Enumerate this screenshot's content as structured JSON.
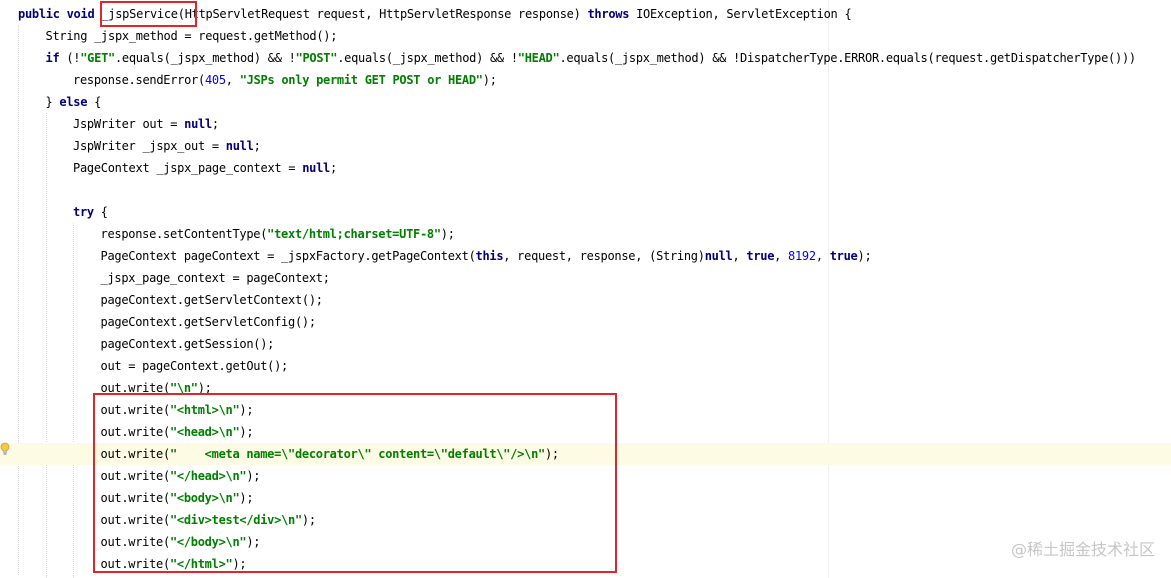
{
  "editor": {
    "language": "java",
    "caret_line_index": 20,
    "lines": [
      {
        "indent": 0,
        "tokens": [
          {
            "t": "public void ",
            "c": "kw"
          },
          {
            "t": "_jspService",
            "c": "p"
          },
          {
            "t": "(HttpServletRequest request, HttpServletResponse response) ",
            "c": "p"
          },
          {
            "t": "throws",
            "c": "kw"
          },
          {
            "t": " IOException, ServletException {",
            "c": "p"
          }
        ]
      },
      {
        "indent": 1,
        "tokens": [
          {
            "t": "String _jspx_method = request.getMethod();",
            "c": "p"
          }
        ]
      },
      {
        "indent": 1,
        "tokens": [
          {
            "t": "if",
            "c": "kw"
          },
          {
            "t": " (!",
            "c": "p"
          },
          {
            "t": "\"GET\"",
            "c": "str"
          },
          {
            "t": ".equals(_jspx_method) && !",
            "c": "p"
          },
          {
            "t": "\"POST\"",
            "c": "str"
          },
          {
            "t": ".equals(_jspx_method) && !",
            "c": "p"
          },
          {
            "t": "\"HEAD\"",
            "c": "str"
          },
          {
            "t": ".equals(_jspx_method) && !DispatcherType.ERROR.equals(request.getDispatcherType()))",
            "c": "p"
          }
        ]
      },
      {
        "indent": 2,
        "tokens": [
          {
            "t": "response.sendError(",
            "c": "p"
          },
          {
            "t": "405",
            "c": "num"
          },
          {
            "t": ", ",
            "c": "p"
          },
          {
            "t": "\"JSPs only permit GET POST or HEAD\"",
            "c": "str"
          },
          {
            "t": ");",
            "c": "p"
          }
        ]
      },
      {
        "indent": 1,
        "tokens": [
          {
            "t": "} ",
            "c": "p"
          },
          {
            "t": "else",
            "c": "kw"
          },
          {
            "t": " {",
            "c": "p"
          }
        ]
      },
      {
        "indent": 2,
        "tokens": [
          {
            "t": "JspWriter out = ",
            "c": "p"
          },
          {
            "t": "null",
            "c": "kw"
          },
          {
            "t": ";",
            "c": "p"
          }
        ]
      },
      {
        "indent": 2,
        "tokens": [
          {
            "t": "JspWriter _jspx_out = ",
            "c": "p"
          },
          {
            "t": "null",
            "c": "kw"
          },
          {
            "t": ";",
            "c": "p"
          }
        ]
      },
      {
        "indent": 2,
        "tokens": [
          {
            "t": "PageContext _jspx_page_context = ",
            "c": "p"
          },
          {
            "t": "null",
            "c": "kw"
          },
          {
            "t": ";",
            "c": "p"
          }
        ]
      },
      {
        "indent": 2,
        "tokens": []
      },
      {
        "indent": 2,
        "tokens": [
          {
            "t": "try",
            "c": "kw"
          },
          {
            "t": " {",
            "c": "p"
          }
        ]
      },
      {
        "indent": 3,
        "tokens": [
          {
            "t": "response.setContentType(",
            "c": "p"
          },
          {
            "t": "\"text/html;charset=UTF-8\"",
            "c": "str"
          },
          {
            "t": ");",
            "c": "p"
          }
        ]
      },
      {
        "indent": 3,
        "tokens": [
          {
            "t": "PageContext pageContext = _jspxFactory.getPageContext(",
            "c": "p"
          },
          {
            "t": "this",
            "c": "kw"
          },
          {
            "t": ", request, response, (String)",
            "c": "p"
          },
          {
            "t": "null",
            "c": "kw"
          },
          {
            "t": ", ",
            "c": "p"
          },
          {
            "t": "true",
            "c": "kw"
          },
          {
            "t": ", ",
            "c": "p"
          },
          {
            "t": "8192",
            "c": "num"
          },
          {
            "t": ", ",
            "c": "p"
          },
          {
            "t": "true",
            "c": "kw"
          },
          {
            "t": ");",
            "c": "p"
          }
        ]
      },
      {
        "indent": 3,
        "tokens": [
          {
            "t": "_jspx_page_context = pageContext;",
            "c": "p"
          }
        ]
      },
      {
        "indent": 3,
        "tokens": [
          {
            "t": "pageContext.getServletContext();",
            "c": "p"
          }
        ]
      },
      {
        "indent": 3,
        "tokens": [
          {
            "t": "pageContext.getServletConfig();",
            "c": "p"
          }
        ]
      },
      {
        "indent": 3,
        "tokens": [
          {
            "t": "pageContext.getSession();",
            "c": "p"
          }
        ]
      },
      {
        "indent": 3,
        "tokens": [
          {
            "t": "out = pageContext.getOut();",
            "c": "p"
          }
        ]
      },
      {
        "indent": 3,
        "tokens": [
          {
            "t": "out.write(",
            "c": "p"
          },
          {
            "t": "\"\\n\"",
            "c": "str"
          },
          {
            "t": ");",
            "c": "p"
          }
        ]
      },
      {
        "indent": 3,
        "tokens": [
          {
            "t": "out.write(",
            "c": "p"
          },
          {
            "t": "\"<html>\\n\"",
            "c": "str"
          },
          {
            "t": ");",
            "c": "p"
          }
        ]
      },
      {
        "indent": 3,
        "tokens": [
          {
            "t": "out.write(",
            "c": "p"
          },
          {
            "t": "\"<head>\\n\"",
            "c": "str"
          },
          {
            "t": ");",
            "c": "p"
          }
        ]
      },
      {
        "indent": 3,
        "tokens": [
          {
            "t": "out.write(",
            "c": "p"
          },
          {
            "t": "\"    <meta name=\\\"decorator\\\" content=\\\"default\\\"/>\\n\"",
            "c": "str"
          },
          {
            "t": ");",
            "c": "p"
          }
        ]
      },
      {
        "indent": 3,
        "tokens": [
          {
            "t": "out.write(",
            "c": "p"
          },
          {
            "t": "\"</head>\\n\"",
            "c": "str"
          },
          {
            "t": ");",
            "c": "p"
          }
        ]
      },
      {
        "indent": 3,
        "tokens": [
          {
            "t": "out.write(",
            "c": "p"
          },
          {
            "t": "\"<body>\\n\"",
            "c": "str"
          },
          {
            "t": ");",
            "c": "p"
          }
        ]
      },
      {
        "indent": 3,
        "tokens": [
          {
            "t": "out.write(",
            "c": "p"
          },
          {
            "t": "\"<div>test</div>\\n\"",
            "c": "str"
          },
          {
            "t": ");",
            "c": "p"
          }
        ]
      },
      {
        "indent": 3,
        "tokens": [
          {
            "t": "out.write(",
            "c": "p"
          },
          {
            "t": "\"</body>\\n\"",
            "c": "str"
          },
          {
            "t": ");",
            "c": "p"
          }
        ]
      },
      {
        "indent": 3,
        "tokens": [
          {
            "t": "out.write(",
            "c": "p"
          },
          {
            "t": "\"</html>\"",
            "c": "str"
          },
          {
            "t": ");",
            "c": "p"
          }
        ]
      }
    ]
  },
  "annotations": {
    "highlight_color": "#e0262a",
    "method_name_box": "_jspService",
    "html_output_box_lines": "out.write(<html> … </html>)"
  },
  "intention_icon": "lightbulb-icon",
  "watermark": {
    "text": "@稀土掘金技术社区"
  },
  "colors": {
    "keyword": "#000080",
    "string": "#008000",
    "number": "#0000ff",
    "caret_line": "#fefbe4",
    "annotation": "#e0262a"
  }
}
